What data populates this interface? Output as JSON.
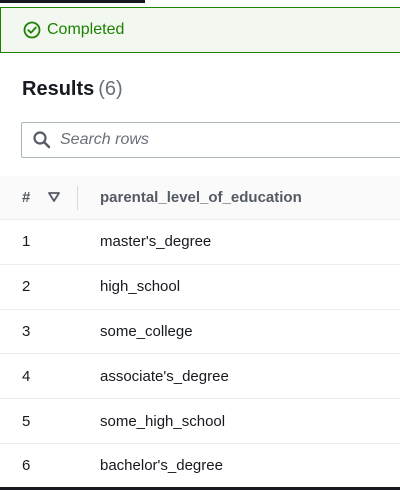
{
  "status": {
    "text": "Completed",
    "color": "#1d8102"
  },
  "results": {
    "title": "Results",
    "count": "(6)"
  },
  "search": {
    "placeholder": "Search rows"
  },
  "table": {
    "columns": [
      "#",
      "parental_level_of_education"
    ],
    "rows": [
      {
        "num": "1",
        "value": "master's_degree"
      },
      {
        "num": "2",
        "value": "high_school"
      },
      {
        "num": "3",
        "value": "some_college"
      },
      {
        "num": "4",
        "value": "associate's_degree"
      },
      {
        "num": "5",
        "value": "some_high_school"
      },
      {
        "num": "6",
        "value": "bachelor's_degree"
      }
    ]
  }
}
